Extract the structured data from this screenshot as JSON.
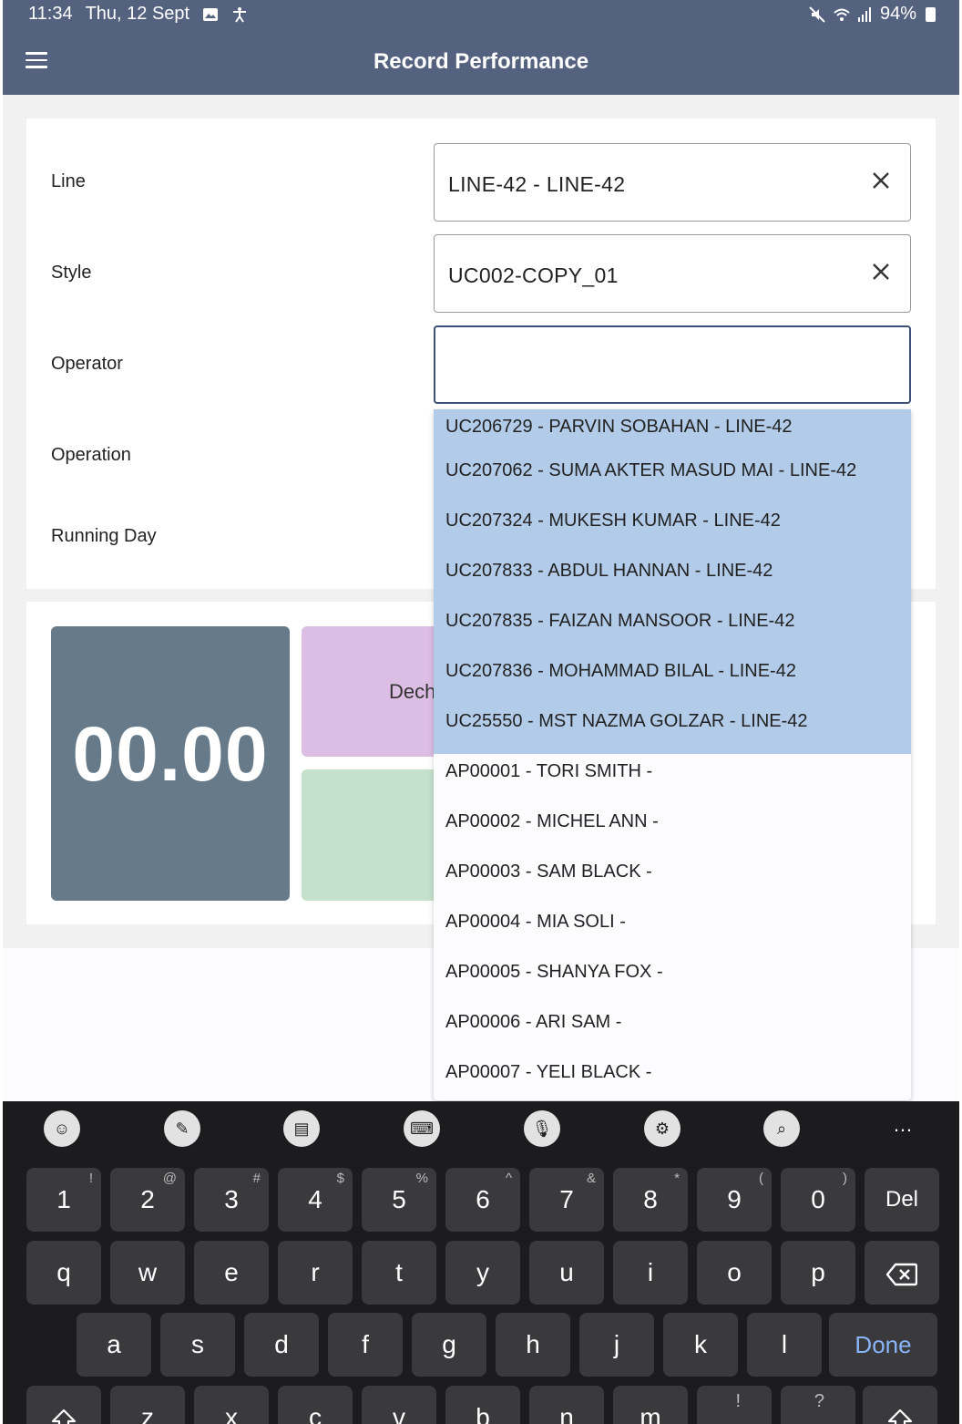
{
  "status": {
    "time": "11:34",
    "date": "Thu, 12 Sept",
    "battery": "94%"
  },
  "app": {
    "title": "Record Performance"
  },
  "form": {
    "labels": {
      "line": "Line",
      "style": "Style",
      "operator": "Operator",
      "operation": "Operation",
      "running_day": "Running Day"
    },
    "line_value": "LINE-42 - LINE-42",
    "style_value": "UC002-COPY_01",
    "operator_value": ""
  },
  "metrics": {
    "big_value": "00.00",
    "tile_label": "Dech"
  },
  "dropdown": {
    "items": [
      {
        "text": "UC206729 - PARVIN  SOBAHAN - LINE-42",
        "selected": true
      },
      {
        "text": "UC207062 - SUMA AKTER  MASUD MAI - LINE-42",
        "selected": true
      },
      {
        "text": "UC207324 - MUKESH  KUMAR  - LINE-42",
        "selected": true
      },
      {
        "text": "UC207833 - ABDUL  HANNAN  - LINE-42",
        "selected": true
      },
      {
        "text": "UC207835 - FAIZAN  MANSOOR - LINE-42",
        "selected": true
      },
      {
        "text": "UC207836 - MOHAMMAD  BILAL  - LINE-42",
        "selected": true
      },
      {
        "text": "UC25550 - MST NAZMA  GOLZAR - LINE-42",
        "selected": true
      },
      {
        "text": "AP00001 - TORI SMITH -",
        "selected": false
      },
      {
        "text": "AP00002 - MICHEL ANN -",
        "selected": false
      },
      {
        "text": "AP00003 - SAM BLACK -",
        "selected": false
      },
      {
        "text": "AP00004 - MIA SOLI -",
        "selected": false
      },
      {
        "text": "AP00005 - SHANYA FOX -",
        "selected": false
      },
      {
        "text": "AP00006 - ARI SAM -",
        "selected": false
      },
      {
        "text": "AP00007 - YELI BLACK -",
        "selected": false
      }
    ]
  },
  "keyboard": {
    "toolbar": [
      "emoji-icon",
      "handwriting-icon",
      "clipboard-icon",
      "keyboard-icon",
      "microphone-icon",
      "settings-icon",
      "search-icon"
    ],
    "more": "…",
    "row1": [
      {
        "k": "1",
        "s": "!"
      },
      {
        "k": "2",
        "s": "@"
      },
      {
        "k": "3",
        "s": "#"
      },
      {
        "k": "4",
        "s": "$"
      },
      {
        "k": "5",
        "s": "%"
      },
      {
        "k": "6",
        "s": "^"
      },
      {
        "k": "7",
        "s": "&"
      },
      {
        "k": "8",
        "s": "*"
      },
      {
        "k": "9",
        "s": "("
      },
      {
        "k": "0",
        "s": ")"
      },
      {
        "k": "Del",
        "s": ""
      }
    ],
    "row2": [
      "q",
      "w",
      "e",
      "r",
      "t",
      "y",
      "u",
      "i",
      "o",
      "p"
    ],
    "row3": [
      "a",
      "s",
      "d",
      "f",
      "g",
      "h",
      "j",
      "k",
      "l"
    ],
    "row4": [
      "z",
      "x",
      "c",
      "v",
      "b",
      "n",
      "m"
    ],
    "row4_sups": [
      {
        "k": "!",
        "pos": 7
      },
      {
        "k": "?",
        "pos": 8
      }
    ],
    "done_label": "Done"
  },
  "colors": {
    "appbar": "#55627f",
    "selected_row": "#b1cbe8",
    "big_box": "#667a8a",
    "tile_purple": "#dcbde3",
    "tile_green": "#c4e1cd",
    "keyboard_bg": "#1c1c1e",
    "done_accent": "#8ab4f8"
  }
}
